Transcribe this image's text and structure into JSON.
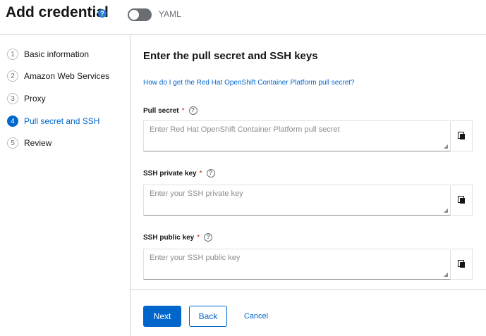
{
  "header": {
    "title": "Add credential",
    "help_icon": "question-circle-icon",
    "yaml_label": "YAML",
    "yaml_toggle": "off"
  },
  "wizard": {
    "steps": [
      {
        "number": "1",
        "label": "Basic information",
        "current": false
      },
      {
        "number": "2",
        "label": "Amazon Web Services",
        "current": false
      },
      {
        "number": "3",
        "label": "Proxy",
        "current": false
      },
      {
        "number": "4",
        "label": "Pull secret and SSH",
        "current": true
      },
      {
        "number": "5",
        "label": "Review",
        "current": false
      }
    ]
  },
  "main": {
    "title": "Enter the pull secret and SSH keys",
    "help_link": "How do I get the Red Hat OpenShift Container Platform pull secret?",
    "fields": [
      {
        "label": "Pull secret",
        "required": "*",
        "value": "",
        "placeholder": "Enter Red Hat OpenShift Container Platform pull secret",
        "action_icon": "copy-icon"
      },
      {
        "label": "SSH private key",
        "required": "*",
        "value": "",
        "placeholder": "Enter your SSH private key",
        "action_icon": "copy-icon"
      },
      {
        "label": "SSH public key",
        "required": "*",
        "value": "",
        "placeholder": "Enter your SSH public key",
        "action_icon": "copy-icon"
      }
    ]
  },
  "footer": {
    "next_label": "Next",
    "back_label": "Back",
    "cancel_label": "Cancel"
  },
  "colors": {
    "accent": "#0066cc",
    "required": "#c9190b",
    "border": "#d2d2d2"
  }
}
